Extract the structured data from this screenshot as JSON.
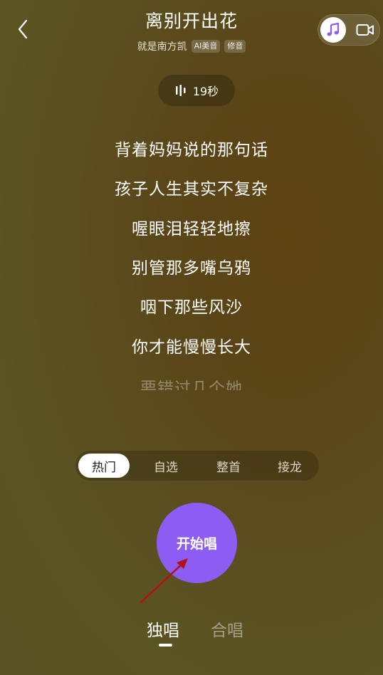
{
  "header": {
    "title": "离别开出花",
    "artist": "就是南方凯",
    "tags": [
      "AI美音",
      "修音"
    ],
    "back_icon": "chevron-left",
    "mode_icons": [
      "music-note-icon",
      "video-camera-icon"
    ]
  },
  "duration": {
    "label": "19秒",
    "icon": "waveform-icon"
  },
  "lyrics": [
    "背着妈妈说的那句话",
    "孩子人生其实不复杂",
    "喔眼泪轻轻地擦",
    "别管那多嘴乌鸦",
    "咽下那些风沙",
    "你才能慢慢长大"
  ],
  "lyric_partial": "要错过几个她",
  "segment_tabs": {
    "items": [
      "热门",
      "自选",
      "整首",
      "接龙"
    ],
    "selected": "热门"
  },
  "start_button": {
    "label": "开始唱"
  },
  "sing_mode": {
    "items": [
      "独唱",
      "合唱"
    ],
    "selected": "独唱"
  },
  "colors": {
    "accent": "#8d5cf3",
    "annotation_arrow": "#b0121b"
  }
}
